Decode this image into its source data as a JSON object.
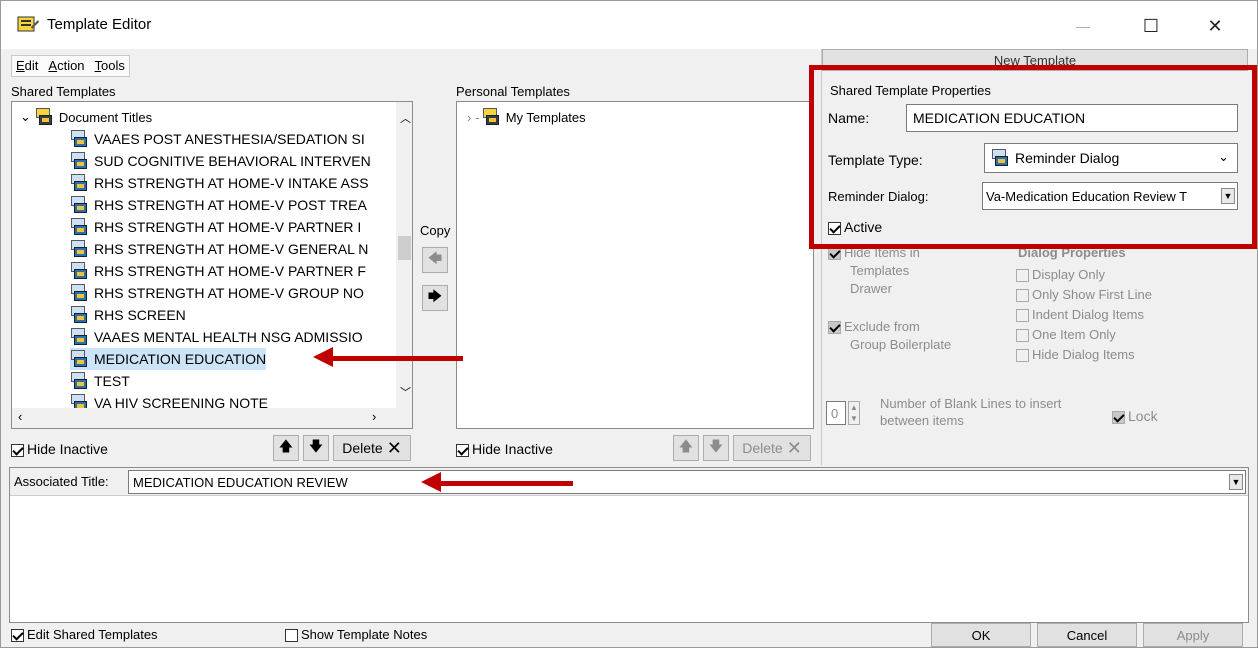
{
  "window": {
    "title": "Template Editor",
    "minimize": "—",
    "maximize": "☐",
    "close": "✕"
  },
  "menu": {
    "edit": "Edit",
    "action": "Action",
    "tools": "Tools"
  },
  "shared": {
    "header": "Shared Templates",
    "root": "Document Titles",
    "items": [
      "VAAES POST ANESTHESIA/SEDATION SI",
      "SUD COGNITIVE BEHAVIORAL INTERVEN",
      "RHS STRENGTH AT HOME-V INTAKE ASS",
      "RHS STRENGTH AT HOME-V POST TREA",
      "RHS STRENGTH AT HOME-V PARTNER I",
      "RHS STRENGTH AT HOME-V GENERAL N",
      "RHS STRENGTH AT HOME-V PARTNER F",
      "RHS STRENGTH AT HOME-V GROUP NO",
      "RHS SCREEN",
      "VAAES MENTAL HEALTH NSG ADMISSIO",
      "MEDICATION EDUCATION",
      "TEST",
      "VA HIV SCREENING NOTE"
    ],
    "hide_inactive": "Hide Inactive",
    "delete": "Delete"
  },
  "copy": {
    "label": "Copy"
  },
  "personal": {
    "header": "Personal Templates",
    "root": "My Templates",
    "hide_inactive": "Hide Inactive",
    "delete": "Delete"
  },
  "props": {
    "tab": "New Template",
    "group": "Shared Template Properties",
    "name_label": "Name:",
    "name_value": "MEDICATION EDUCATION",
    "type_label": "Template Type:",
    "type_value": "Reminder Dialog",
    "dialog_label": "Reminder Dialog:",
    "dialog_value": "Va-Medication Education Review T",
    "active": "Active",
    "hide_items_1": "Hide Items in",
    "hide_items_2": "Templates",
    "hide_items_3": "Drawer",
    "exclude_1": "Exclude from",
    "exclude_2": "Group Boilerplate",
    "dialog_props": "Dialog Properties",
    "display_only": "Display Only",
    "only_first": "Only Show First Line",
    "indent": "Indent Dialog Items",
    "one_item": "One Item Only",
    "hide_dialog": "Hide Dialog Items",
    "blank_value": "0",
    "blank_1": "Number of Blank Lines to insert",
    "blank_2": "between items",
    "lock": "Lock"
  },
  "assoc": {
    "label": "Associated Title:",
    "value": "MEDICATION EDUCATION REVIEW"
  },
  "footer": {
    "edit_shared": "Edit Shared Templates",
    "show_notes": "Show Template Notes",
    "ok": "OK",
    "cancel": "Cancel",
    "apply": "Apply"
  },
  "colors": {
    "highlight": "#c00000",
    "selection": "#cce4f7"
  }
}
